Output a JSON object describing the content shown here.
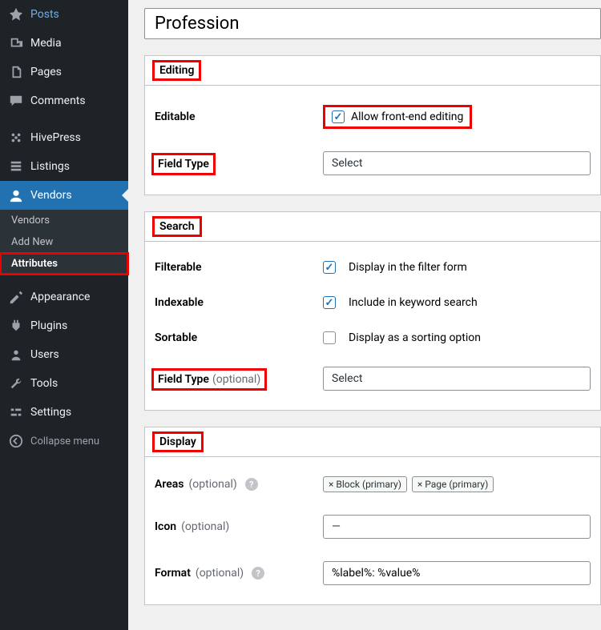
{
  "title_value": "Profession",
  "sidebar": {
    "posts": "Posts",
    "media": "Media",
    "pages": "Pages",
    "comments": "Comments",
    "hivepress": "HivePress",
    "listings": "Listings",
    "vendors": "Vendors",
    "sub_vendors": "Vendors",
    "sub_addnew": "Add New",
    "sub_attributes": "Attributes",
    "appearance": "Appearance",
    "plugins": "Plugins",
    "users": "Users",
    "tools": "Tools",
    "settings": "Settings",
    "collapse": "Collapse menu"
  },
  "panels": {
    "editing": {
      "title": "Editing",
      "editable_label": "Editable",
      "editable_check": "Allow front-end editing",
      "fieldtype_label": "Field Type",
      "fieldtype_value": "Select"
    },
    "search": {
      "title": "Search",
      "filterable_label": "Filterable",
      "filterable_check": "Display in the filter form",
      "indexable_label": "Indexable",
      "indexable_check": "Include in keyword search",
      "sortable_label": "Sortable",
      "sortable_check": "Display as a sorting option",
      "fieldtype_label": "Field Type",
      "fieldtype_opt": "(optional)",
      "fieldtype_value": "Select"
    },
    "display": {
      "title": "Display",
      "areas_label": "Areas",
      "areas_opt": "(optional)",
      "areas_tag1": "× Block (primary)",
      "areas_tag2": "× Page (primary)",
      "icon_label": "Icon",
      "icon_opt": "(optional)",
      "icon_value": "—",
      "format_label": "Format",
      "format_opt": "(optional)",
      "format_value": "%label%: %value%"
    }
  }
}
